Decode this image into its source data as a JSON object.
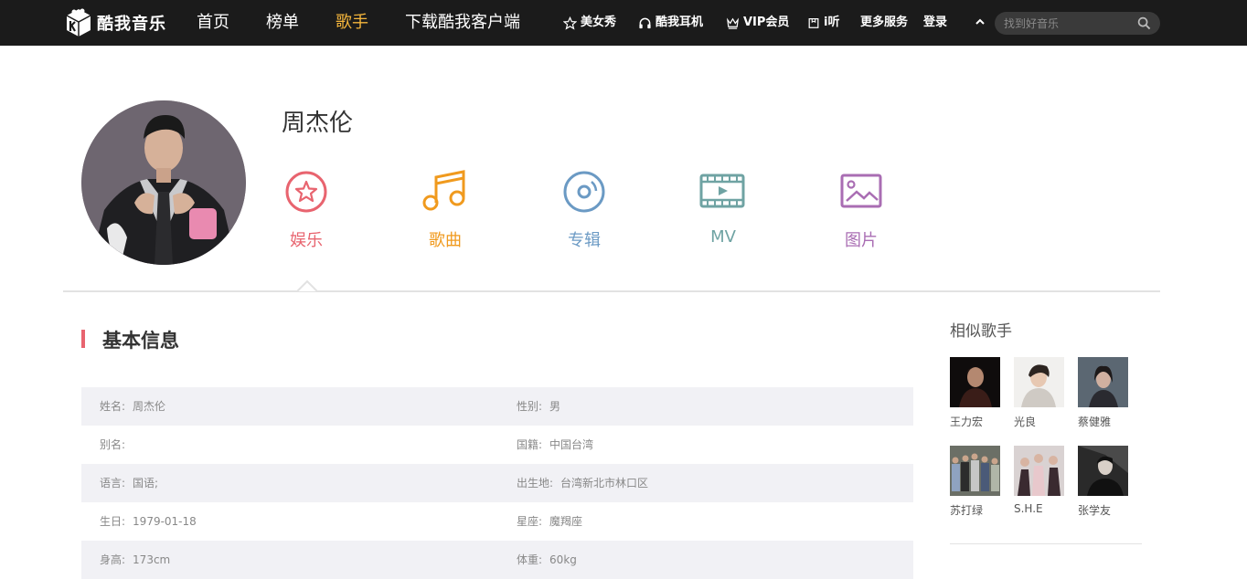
{
  "brand": {
    "name": "酷我音乐",
    "logo_icon": "kuwo-cube-logo"
  },
  "nav": {
    "items": [
      {
        "label": "首页",
        "active": false
      },
      {
        "label": "榜单",
        "active": false
      },
      {
        "label": "歌手",
        "active": true
      },
      {
        "label": "下载酷我客户端",
        "active": false
      }
    ],
    "sub": [
      {
        "label": "美女秀",
        "icon": "star-outline-icon"
      },
      {
        "label": "酷我耳机",
        "icon": "headphones-icon"
      },
      {
        "label": "VIP会员",
        "icon": "crown-icon"
      },
      {
        "label": "i听",
        "icon": "box-icon"
      },
      {
        "label": "更多服务",
        "icon": ""
      },
      {
        "label": "登录",
        "icon": ""
      }
    ],
    "search_placeholder": "找到好音乐"
  },
  "artist": {
    "name": "周杰伦",
    "categories": [
      {
        "label": "娱乐",
        "color": "#e8646f",
        "icon": "star-circle-icon"
      },
      {
        "label": "歌曲",
        "color": "#f09a1e",
        "icon": "music-note-icon"
      },
      {
        "label": "专辑",
        "color": "#6b9ac4",
        "icon": "disc-icon"
      },
      {
        "label": "MV",
        "color": "#6fa3a3",
        "icon": "film-icon"
      },
      {
        "label": "图片",
        "color": "#a96db3",
        "icon": "image-icon"
      }
    ]
  },
  "basic_info": {
    "title": "基本信息",
    "rows": [
      {
        "l_label": "姓名:",
        "l_value": "周杰伦",
        "r_label": "性别:",
        "r_value": "男"
      },
      {
        "l_label": "别名:",
        "l_value": "",
        "r_label": "国籍:",
        "r_value": "中国台湾"
      },
      {
        "l_label": "语言:",
        "l_value": "国语;",
        "r_label": "出生地:",
        "r_value": "台湾新北市林口区"
      },
      {
        "l_label": "生日:",
        "l_value": "1979-01-18",
        "r_label": "星座:",
        "r_value": "魔羯座"
      },
      {
        "l_label": "身高:",
        "l_value": "173cm",
        "r_label": "体重:",
        "r_value": "60kg"
      }
    ]
  },
  "similar": {
    "title": "相似歌手",
    "artists": [
      {
        "name": "王力宏"
      },
      {
        "name": "光良"
      },
      {
        "name": "蔡健雅"
      },
      {
        "name": "苏打绿"
      },
      {
        "name": "S.H.E"
      },
      {
        "name": "张学友"
      }
    ]
  }
}
